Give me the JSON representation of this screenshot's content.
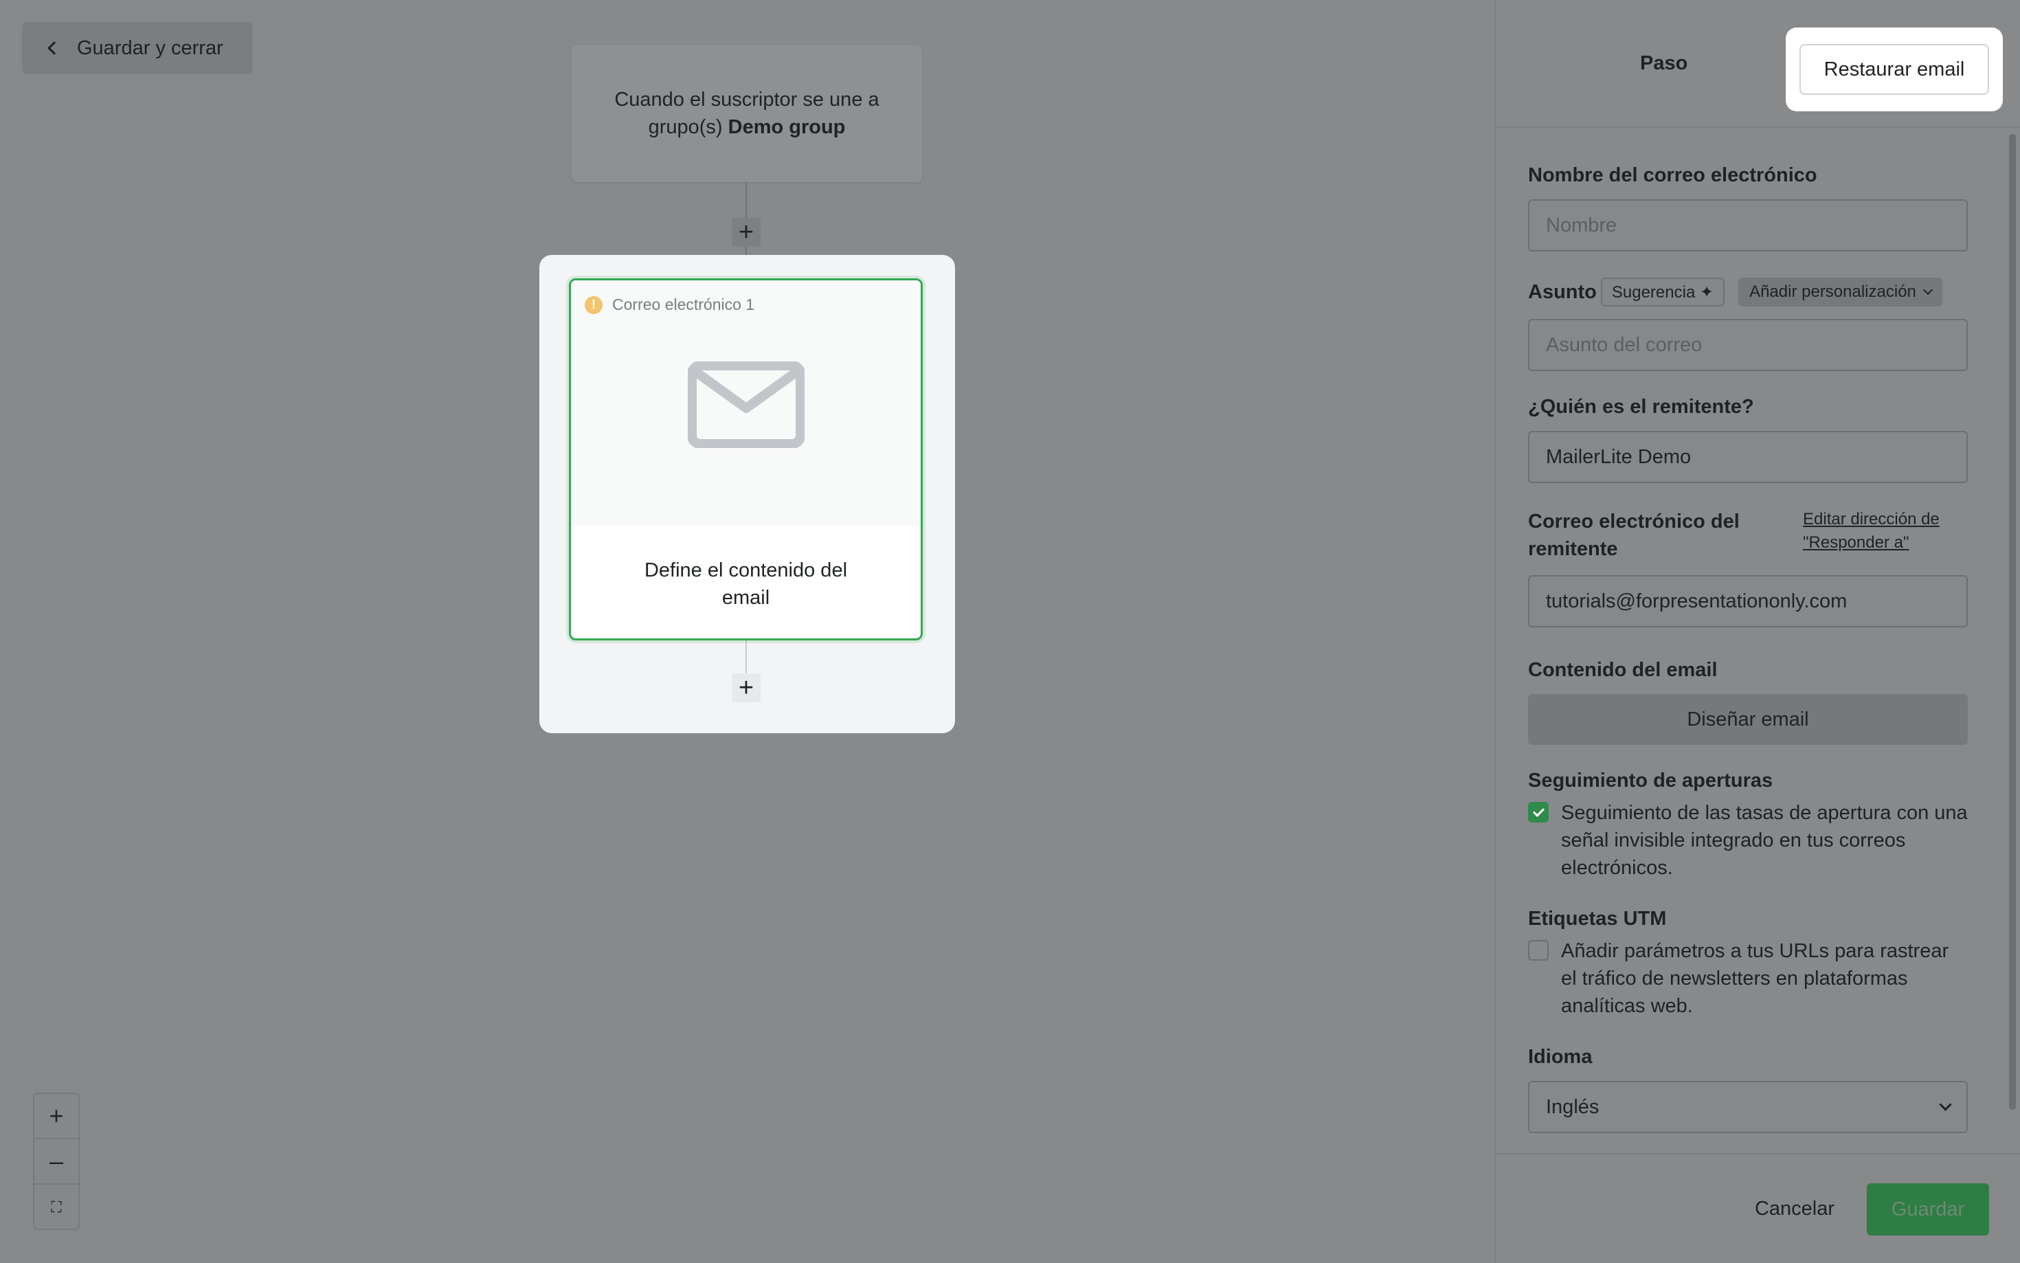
{
  "canvas": {
    "back_label": "Guardar y cerrar",
    "trigger": {
      "text_prefix": "Cuando el suscriptor se une a grupo(s) ",
      "group_name": "Demo group"
    },
    "email_step": {
      "label": "Correo electrónico 1",
      "body": "Define el contenido del email"
    },
    "add_step_symbol": "+",
    "zoom": {
      "in": "+",
      "out": "–",
      "fit": "⛶"
    }
  },
  "panel": {
    "title": "Paso",
    "restore_label": "Restaurar email",
    "email_name": {
      "label": "Nombre del correo electrónico",
      "placeholder": "Nombre",
      "value": ""
    },
    "subject": {
      "label": "Asunto",
      "suggestion_label": "Sugerencia ✦",
      "personalize_label": "Añadir personalización",
      "placeholder": "Asunto del correo",
      "value": ""
    },
    "sender_name": {
      "label": "¿Quién es el remitente?",
      "value": "MailerLite Demo"
    },
    "sender_email": {
      "label": "Correo electrónico del remitente",
      "reply_to_link": "Editar dirección de \"Responder a\"",
      "value": "tutorials@forpresentationonly.com"
    },
    "content": {
      "label": "Contenido del email",
      "design_label": "Diseñar email"
    },
    "open_tracking": {
      "label": "Seguimiento de aperturas",
      "checked": true,
      "text": "Seguimiento de las tasas de apertura con una señal invisible integrado en tus correos electrónicos."
    },
    "utm": {
      "label": "Etiquetas UTM",
      "checked": false,
      "text": "Añadir parámetros a tus URLs para rastrear el tráfico de newsletters en plataformas analíticas web."
    },
    "language": {
      "label": "Idioma",
      "selected": "Inglés"
    },
    "footer": {
      "cancel_label": "Cancelar",
      "save_label": "Guardar"
    }
  },
  "colors": {
    "accent_green": "#2e8b4a",
    "warning": "#f2c46b",
    "overlay": "#88898c"
  }
}
